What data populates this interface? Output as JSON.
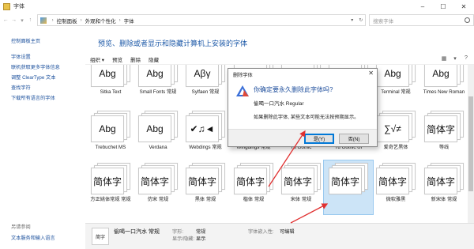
{
  "window": {
    "title": "字体"
  },
  "address": {
    "crumbs": [
      "控制面板",
      "外观和个性化",
      "字体"
    ],
    "search_placeholder": "搜索字体"
  },
  "sidebar": {
    "home": "控制面板主页",
    "links": [
      "字体设置",
      "联机获取更多字体信息",
      "调整 ClearType 文本",
      "查找字符",
      "下载所有语言的字体"
    ],
    "see_also_heading": "另请参阅",
    "see_also": [
      "文本服务和输入语言"
    ]
  },
  "main": {
    "title": "预览、删除或者显示和隐藏计算机上安装的字体",
    "toolbar": [
      "组织 ▾",
      "预览",
      "删除",
      "隐藏"
    ]
  },
  "fonts": [
    {
      "sample": "Abg",
      "name": "Sitka Text"
    },
    {
      "sample": "Abg",
      "name": "Small Fonts 常规"
    },
    {
      "sample": "Aβγ",
      "name": "Sylfaen 常规"
    },
    {
      "sample": "",
      "name": ""
    },
    {
      "sample": "",
      "name": ""
    },
    {
      "sample": "",
      "name": ""
    },
    {
      "sample": "Abg",
      "name": "Terminal 常规"
    },
    {
      "sample": "Abg",
      "name": "Times New Roman"
    },
    {
      "sample": "Abg",
      "name": "Trebuchet MS"
    },
    {
      "sample": "Abg",
      "name": "Verdana"
    },
    {
      "sample": "✔♫◄",
      "name": "Webdings 常规"
    },
    {
      "sample": "",
      "name": "Wingdings 常规"
    },
    {
      "sample": "",
      "name": "Yu Gothic"
    },
    {
      "sample": "",
      "name": "Yu Gothic UI"
    },
    {
      "sample": "∑√≠",
      "name": "爱奇艺黑体"
    },
    {
      "sample": "简体字",
      "name": "等线"
    },
    {
      "sample": "简体字",
      "name": "方正姚体常规 常规"
    },
    {
      "sample": "简体字",
      "name": "仿宋 常规"
    },
    {
      "sample": "简体字",
      "name": "黑体 常规"
    },
    {
      "sample": "简体字",
      "name": "楷体 常规"
    },
    {
      "sample": "简体字",
      "name": "宋体 常规"
    },
    {
      "sample": "简体字",
      "name": "偷喝一口汽水 常规"
    },
    {
      "sample": "简体字",
      "name": "微软雅黑"
    },
    {
      "sample": "简体字",
      "name": "新宋体 常规"
    }
  ],
  "selected_index": 21,
  "details": {
    "name": "偷喝一口汽水 常规",
    "style_key": "字形:",
    "style_val": "常规",
    "show_key": "显示/隐藏:",
    "show_val": "显示",
    "embed_key": "字体嵌入性:",
    "embed_val": "可编辑"
  },
  "dialog": {
    "title": "删除字体",
    "question": "你确定要永久删除此字体吗?",
    "font": "偷喝一口汽水 Regular",
    "message": "如果删除此字体, 某些文本可能无法按预期显示。",
    "yes": "是(Y)",
    "no": "否(N)"
  }
}
